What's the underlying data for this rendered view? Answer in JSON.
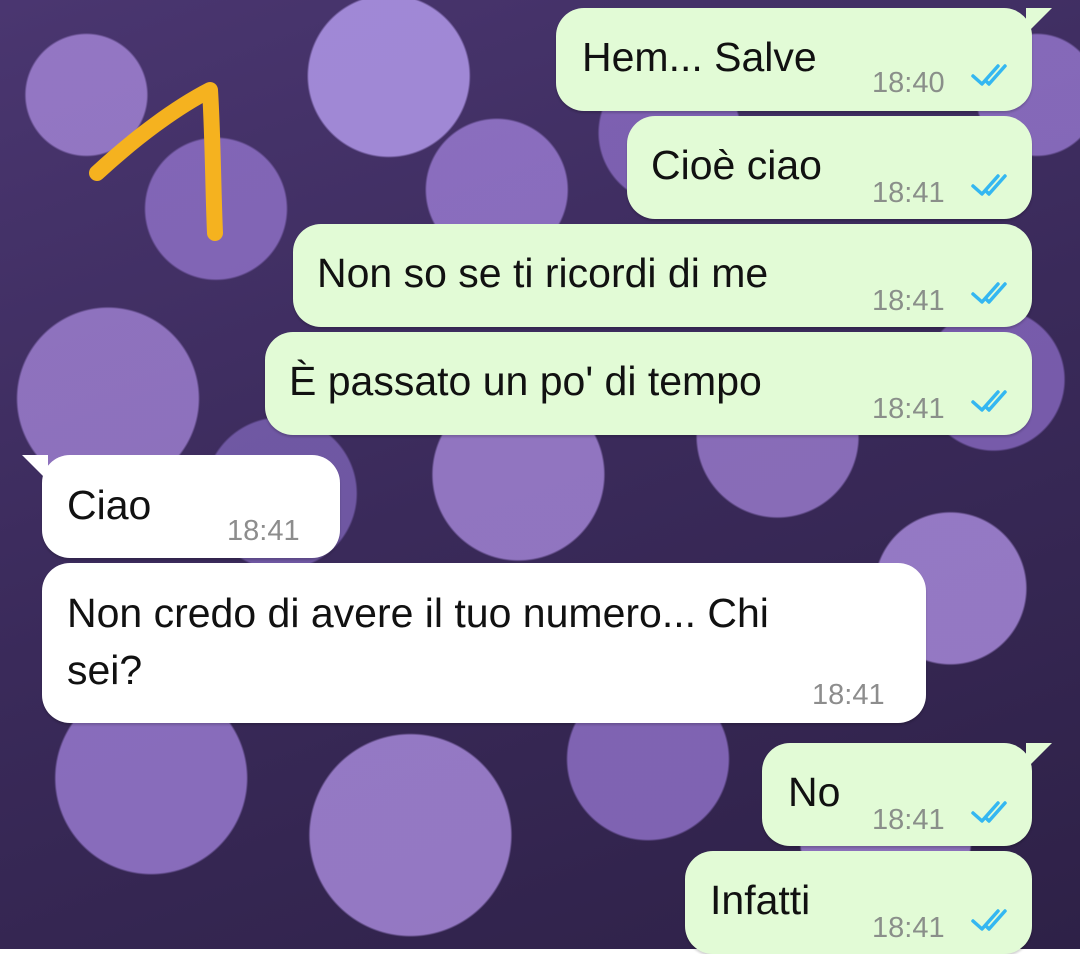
{
  "colors": {
    "outgoing_bubble": "#e2fbd6",
    "incoming_bubble": "#ffffff",
    "read_ticks": "#34b7f1",
    "annotation_arrow": "#f5b21f"
  },
  "messages": [
    {
      "direction": "outgoing",
      "text": "Hem... Salve",
      "time": "18:40",
      "status_icon": "double-check-read-icon"
    },
    {
      "direction": "outgoing",
      "text": "Cioè ciao",
      "time": "18:41",
      "status_icon": "double-check-read-icon"
    },
    {
      "direction": "outgoing",
      "text": "Non so se ti ricordi di me",
      "time": "18:41",
      "status_icon": "double-check-read-icon"
    },
    {
      "direction": "outgoing",
      "text": "È passato un po' di tempo",
      "time": "18:41",
      "status_icon": "double-check-read-icon"
    },
    {
      "direction": "incoming",
      "text": "Ciao",
      "time": "18:41"
    },
    {
      "direction": "incoming",
      "text_line1": "Non credo di avere il tuo numero... Chi",
      "text_line2": "sei?",
      "time": "18:41"
    },
    {
      "direction": "outgoing",
      "text": "No",
      "time": "18:41",
      "status_icon": "double-check-read-icon"
    },
    {
      "direction": "outgoing",
      "text": "Infatti",
      "time": "18:41",
      "status_icon": "double-check-read-icon"
    }
  ]
}
